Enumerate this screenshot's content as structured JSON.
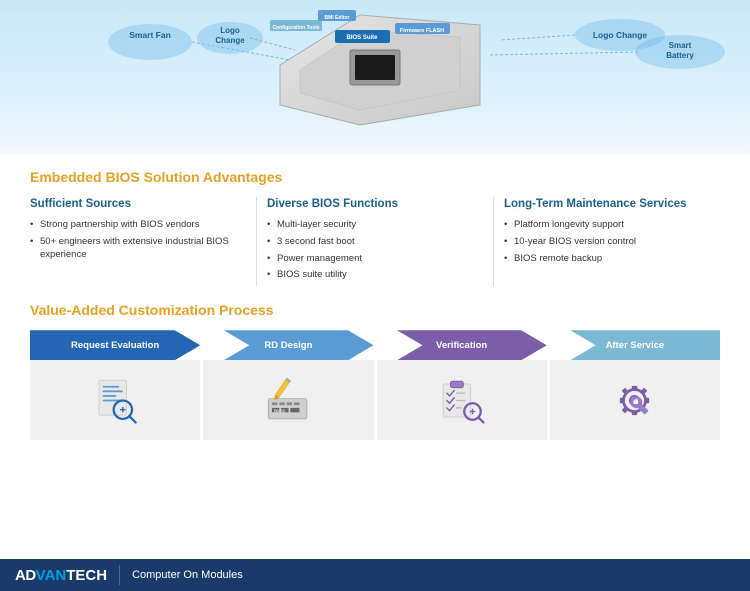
{
  "diagram": {
    "labels": {
      "smart_fan": "Smart Fan",
      "logo_change_left": "Logo\nChange",
      "bios_suite": "BIOS Suite",
      "firmware_flash": "Firmware FLASH",
      "configuration_tools": "Configuration\nTools",
      "logo_change_right": "Logo Change",
      "bmi_editor": "BMI Editor",
      "smart_battery": "Smart Battery"
    }
  },
  "advantages": {
    "section_title": "Embedded BIOS Solution Advantages",
    "columns": [
      {
        "title": "Sufficient Sources",
        "items": [
          "Strong partnership with BIOS vendors",
          "50+ engineers with extensive industrial BIOS experience"
        ]
      },
      {
        "title": "Diverse BIOS Functions",
        "items": [
          "Multi-layer security",
          "3 second fast boot",
          "Power management",
          "BIOS suite utility"
        ]
      },
      {
        "title": "Long-Term Maintenance Services",
        "items": [
          "Platform longevity support",
          "10-year BIOS version control",
          "BIOS remote backup"
        ]
      }
    ]
  },
  "process": {
    "section_title": "Value-Added Customization Process",
    "steps": [
      {
        "id": "step-1",
        "label": "Request Evaluation",
        "color": "#2466b3",
        "icon": "search-doc"
      },
      {
        "id": "step-2",
        "label": "RD Design",
        "color": "#5b9bd5",
        "icon": "bios-chip"
      },
      {
        "id": "step-3",
        "label": "Verification",
        "color": "#7b5ea7",
        "icon": "checklist-search"
      },
      {
        "id": "step-4",
        "label": "After Service",
        "color": "#7bb8d4",
        "icon": "wrench-gear"
      }
    ]
  },
  "footer": {
    "brand_ad": "AD",
    "brand_van": "VAN",
    "brand_tech": "TECH",
    "subtitle": "Computer On Modules"
  }
}
